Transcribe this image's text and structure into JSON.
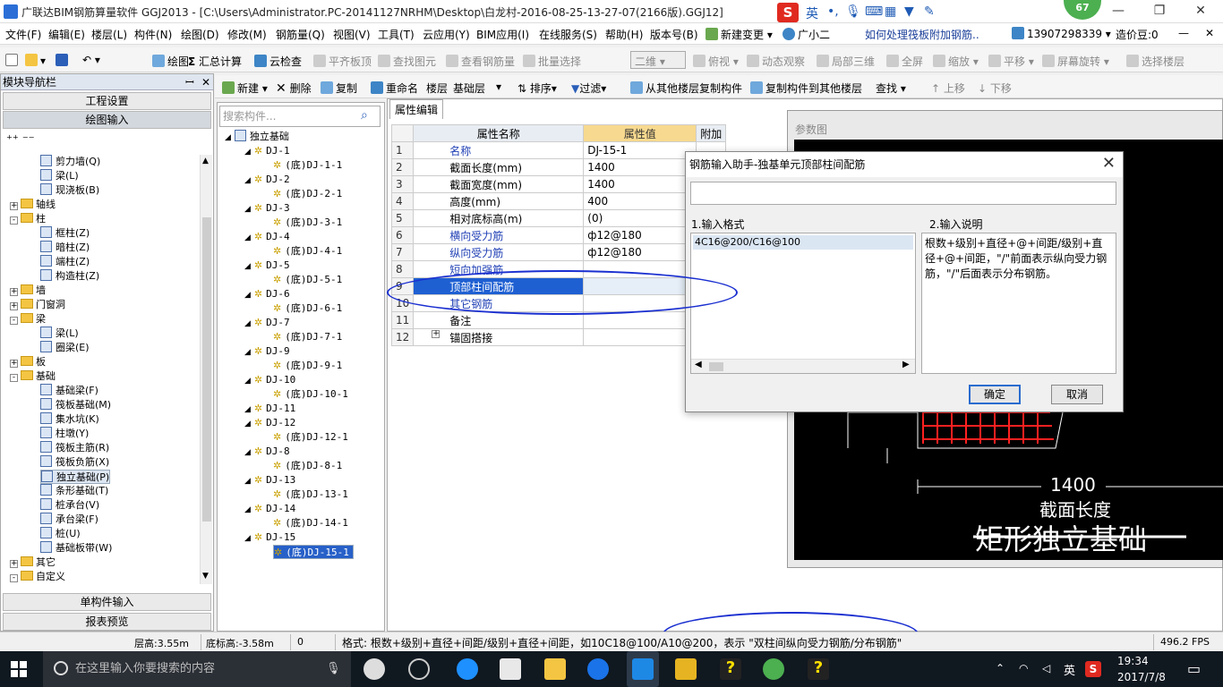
{
  "titlebar": {
    "title": "广联达BIM钢筋算量软件 GGJ2013 - [C:\\Users\\Administrator.PC-20141127NRHM\\Desktop\\白龙村-2016-08-25-13-27-07(2166版).GGJ12]",
    "ime_lang": "英",
    "badge": "67"
  },
  "menubar": {
    "items": [
      "文件(F)",
      "编辑(E)",
      "楼层(L)",
      "构件(N)",
      "绘图(D)",
      "修改(M)",
      "钢筋量(Q)",
      "视图(V)",
      "工具(T)",
      "云应用(Y)",
      "BIM应用(I)",
      "在线服务(S)",
      "帮助(H)",
      "版本号(B)",
      "新建变更",
      "广小二"
    ],
    "question": "如何处理筏板附加钢筋..",
    "phone": "13907298339",
    "zaojia": "造价豆:0"
  },
  "toolbar1": {
    "draw": "绘图",
    "sum": "汇总计算",
    "cloudcheck": "云检查",
    "align_top": "平齐板顶",
    "find_element": "查找图元",
    "view_rebar": "查看钢筋量",
    "batch_select": "批量选择",
    "view_mode": "二维",
    "top_view": "俯视",
    "dynamic": "动态观察",
    "local3d": "局部三维",
    "fullscreen": "全屏",
    "zoom": "缩放",
    "pan": "平移",
    "rotate": "屏幕旋转",
    "select_floor": "选择楼层"
  },
  "nav": {
    "header": "模块导航栏",
    "pin": "ꟷ x",
    "project_settings": "工程设置",
    "draw_input": "绘图输入",
    "single_input": "单构件输入",
    "report_preview": "报表预览",
    "tree": [
      {
        "label": "剪力墙(Q)",
        "level": 2
      },
      {
        "label": "梁(L)",
        "level": 2
      },
      {
        "label": "现浇板(B)",
        "level": 2
      },
      {
        "label": "轴线",
        "level": 1,
        "folder": true,
        "toggle": "+"
      },
      {
        "label": "柱",
        "level": 1,
        "folder": true,
        "toggle": "-"
      },
      {
        "label": "框柱(Z)",
        "level": 2
      },
      {
        "label": "暗柱(Z)",
        "level": 2
      },
      {
        "label": "端柱(Z)",
        "level": 2
      },
      {
        "label": "构造柱(Z)",
        "level": 2
      },
      {
        "label": "墙",
        "level": 1,
        "folder": true,
        "toggle": "+"
      },
      {
        "label": "门窗洞",
        "level": 1,
        "folder": true,
        "toggle": "+"
      },
      {
        "label": "梁",
        "level": 1,
        "folder": true,
        "toggle": "-"
      },
      {
        "label": "梁(L)",
        "level": 2
      },
      {
        "label": "圈梁(E)",
        "level": 2
      },
      {
        "label": "板",
        "level": 1,
        "folder": true,
        "toggle": "+"
      },
      {
        "label": "基础",
        "level": 1,
        "folder": true,
        "toggle": "-"
      },
      {
        "label": "基础梁(F)",
        "level": 2
      },
      {
        "label": "筏板基础(M)",
        "level": 2
      },
      {
        "label": "集水坑(K)",
        "level": 2
      },
      {
        "label": "柱墩(Y)",
        "level": 2
      },
      {
        "label": "筏板主筋(R)",
        "level": 2
      },
      {
        "label": "筏板负筋(X)",
        "level": 2
      },
      {
        "label": "独立基础(P)",
        "level": 2,
        "selected": true
      },
      {
        "label": "条形基础(T)",
        "level": 2
      },
      {
        "label": "桩承台(V)",
        "level": 2
      },
      {
        "label": "承台梁(F)",
        "level": 2
      },
      {
        "label": "桩(U)",
        "level": 2
      },
      {
        "label": "基础板带(W)",
        "level": 2
      },
      {
        "label": "其它",
        "level": 1,
        "folder": true,
        "toggle": "+"
      },
      {
        "label": "自定义",
        "level": 1,
        "folder": true,
        "toggle": "-"
      }
    ]
  },
  "toolbar2": {
    "new": "新建",
    "delete": "删除",
    "copy": "复制",
    "rename": "重命名",
    "floor_label": "楼层",
    "floor_value": "基础层",
    "sort": "排序",
    "filter": "过滤",
    "copy_from": "从其他楼层复制构件",
    "copy_to": "复制构件到其他楼层",
    "find": "查找",
    "up": "上移",
    "down": "下移"
  },
  "elements": {
    "search_placeholder": "搜索构件...",
    "root": "独立基础",
    "items": [
      {
        "name": "DJ-1",
        "child": "(底)DJ-1-1"
      },
      {
        "name": "DJ-2",
        "child": "(底)DJ-2-1"
      },
      {
        "name": "DJ-3",
        "child": "(底)DJ-3-1"
      },
      {
        "name": "DJ-4",
        "child": "(底)DJ-4-1"
      },
      {
        "name": "DJ-5",
        "child": "(底)DJ-5-1"
      },
      {
        "name": "DJ-6",
        "child": "(底)DJ-6-1"
      },
      {
        "name": "DJ-7",
        "child": "(底)DJ-7-1"
      },
      {
        "name": "DJ-9",
        "child": "(底)DJ-9-1"
      },
      {
        "name": "DJ-10",
        "child": "(底)DJ-10-1"
      },
      {
        "name": "DJ-11",
        "child": ""
      },
      {
        "name": "DJ-12",
        "child": "(底)DJ-12-1"
      },
      {
        "name": "DJ-8",
        "child": "(底)DJ-8-1"
      },
      {
        "name": "DJ-13",
        "child": "(底)DJ-13-1"
      },
      {
        "name": "DJ-14",
        "child": "(底)DJ-14-1"
      },
      {
        "name": "DJ-15",
        "child": "(底)DJ-15-1"
      }
    ]
  },
  "props": {
    "tab": "属性编辑",
    "col_name": "属性名称",
    "col_value": "属性值",
    "col_extra": "附加",
    "rows": [
      {
        "n": "1",
        "name": "名称",
        "value": "DJ-15-1",
        "blue": true
      },
      {
        "n": "2",
        "name": "截面长度(mm)",
        "value": "1400"
      },
      {
        "n": "3",
        "name": "截面宽度(mm)",
        "value": "1400"
      },
      {
        "n": "4",
        "name": "高度(mm)",
        "value": "400"
      },
      {
        "n": "5",
        "name": "相对底标高(m)",
        "value": "(0)"
      },
      {
        "n": "6",
        "name": "横向受力筋",
        "value": "ф12@180",
        "blue": true
      },
      {
        "n": "7",
        "name": "纵向受力筋",
        "value": "ф12@180",
        "blue": true
      },
      {
        "n": "8",
        "name": "短向加强筋",
        "value": "",
        "blue": true
      },
      {
        "n": "9",
        "name": "顶部柱间配筋",
        "value": "",
        "selected": true
      },
      {
        "n": "10",
        "name": "其它钢筋",
        "value": "",
        "blue": true
      },
      {
        "n": "11",
        "name": "备注",
        "value": ""
      },
      {
        "n": "12",
        "name": "锚固搭接",
        "value": "",
        "expand": true
      }
    ]
  },
  "param": {
    "title": "参数图",
    "dim": "1400",
    "dim_label": "截面长度",
    "name": "矩形独立基础"
  },
  "dialog": {
    "title": "钢筋输入助手-独基单元顶部柱间配筋",
    "input_value": "",
    "format_label": "1.输入格式",
    "desc_label": "2.输入说明",
    "format_item": "4C16@200/C16@100",
    "description": "根数+级别+直径+@+间距/级别+直径+@+间距，\"/\"前面表示纵向受力钢筋，\"/\"后面表示分布钢筋。",
    "ok": "确定",
    "cancel": "取消"
  },
  "status": {
    "floor_height": "层高:3.55m",
    "bottom_elev": "底标高:-3.58m",
    "zero": "0",
    "hint": "格式: 根数+级别+直径+间距/级别+直径+间距，如10C18@100/A10@200，表示 \"双柱间纵向受力钢筋/分布钢筋\"",
    "fps": "496.2 FPS"
  },
  "taskbar": {
    "search_placeholder": "在这里输入你要搜索的内容",
    "ime": "英",
    "time": "19:34",
    "date": "2017/7/8"
  }
}
